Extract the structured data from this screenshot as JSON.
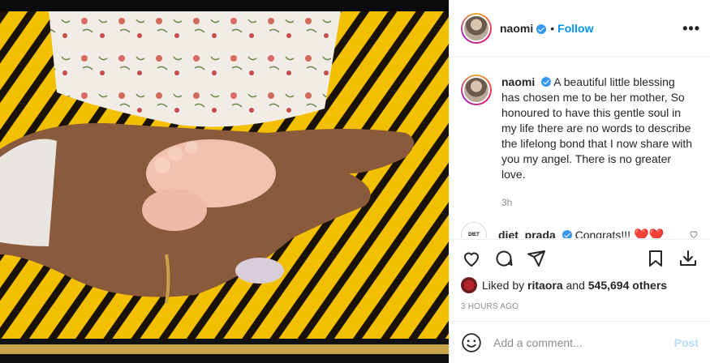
{
  "post": {
    "username": "naomi",
    "follow_label": "Follow",
    "dot_separator": "•",
    "more_label": "•••",
    "caption": "A beautiful little blessing has chosen me to be her mother, So honoured to have this gentle soul in my life there are no words to describe the lifelong bond that I now share with you my angel. There is no greater love.",
    "time_ago": "3h"
  },
  "comment": {
    "avatar_text": "DIET",
    "username": "diet_prada",
    "text": "Congrats!!!",
    "hearts": "❤️❤️",
    "like_icon": "heart-outline-icon"
  },
  "likes": {
    "prefix": "Liked by",
    "first_user": "ritaora",
    "connector": "and",
    "others": "545,694 others"
  },
  "posted_label": "3 HOURS AGO",
  "add_comment": {
    "placeholder": "Add a comment...",
    "post_label": "Post"
  },
  "icons": {
    "like": "heart-icon",
    "comment": "comment-icon",
    "share": "share-icon",
    "save": "bookmark-icon",
    "download": "download-icon",
    "emoji": "emoji-icon",
    "verified": "verified-badge-icon"
  },
  "colors": {
    "link_blue": "#0095f6",
    "verified_blue": "#3897f0",
    "post_disabled": "#b2dffc",
    "heart_red": "#ed4956",
    "photo_yellow": "#e8b400"
  }
}
